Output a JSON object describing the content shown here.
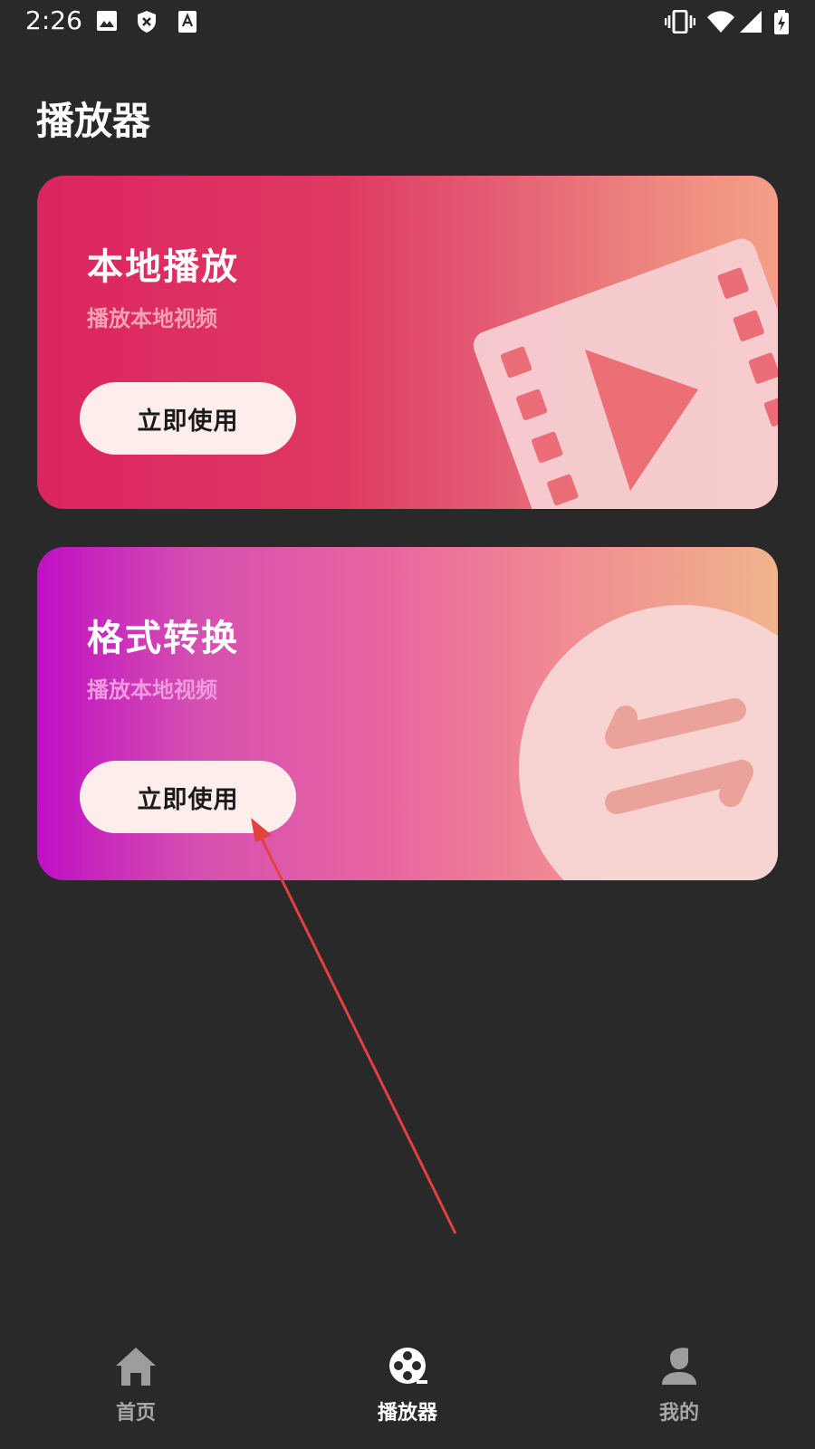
{
  "status_bar": {
    "time": "2:26",
    "left_icons": [
      "image-icon",
      "shield-x-icon",
      "font-a-icon"
    ],
    "right_icons": [
      "vibrate-icon",
      "wifi-icon",
      "signal-icon",
      "battery-charging-icon"
    ]
  },
  "page": {
    "title": "播放器"
  },
  "cards": [
    {
      "title": "本地播放",
      "subtitle": "播放本地视频",
      "button_label": "立即使用",
      "art_icon": "film-play-icon",
      "gradient": [
        "#dc2560",
        "#f49f87"
      ]
    },
    {
      "title": "格式转换",
      "subtitle": "播放本地视频",
      "button_label": "立即使用",
      "art_icon": "swap-arrows-icon",
      "gradient": [
        "#bf0fc4",
        "#f0b48c"
      ]
    }
  ],
  "bottom_nav": {
    "items": [
      {
        "label": "首页",
        "icon": "home-icon",
        "active": false
      },
      {
        "label": "播放器",
        "icon": "film-reel-icon",
        "active": true
      },
      {
        "label": "我的",
        "icon": "user-icon",
        "active": false
      }
    ]
  },
  "colors": {
    "background": "#2a292a",
    "annotation_arrow": "#e3403e",
    "nav_active": "#ffffff",
    "nav_inactive": "#a7a7a7"
  }
}
